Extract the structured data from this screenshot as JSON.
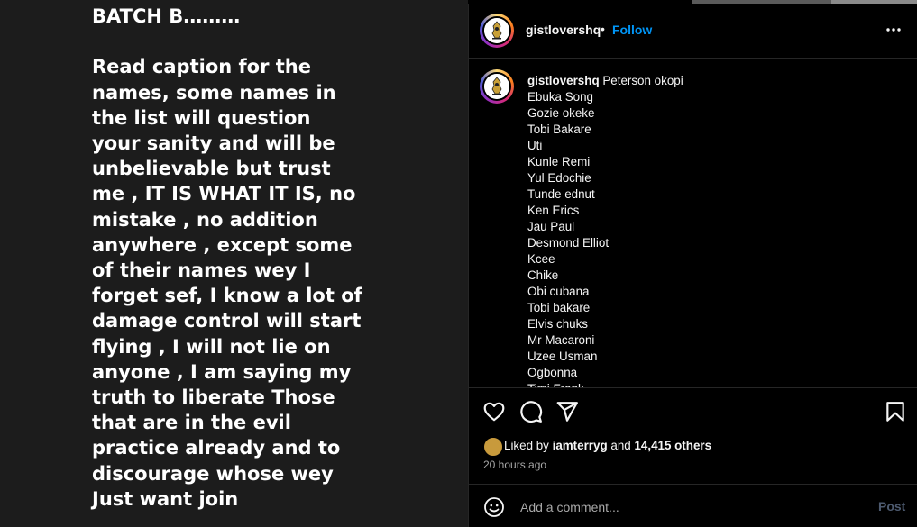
{
  "post_image": {
    "text": "BATCH B………\n\nRead caption for the names, some names in the list will question your sanity and will be unbelievable but trust me , IT IS WHAT IT IS, no mistake , no addition anywhere , except some of their names wey I forget sef, I know a lot of damage control will start flying , I will not lie on anyone , I am saying my truth to liberate Those that are in the evil practice already and to discourage whose wey Just want join"
  },
  "header": {
    "username": "gistlovershq",
    "separator": "•",
    "follow_label": "Follow",
    "more_icon": "more-horizontal-icon"
  },
  "caption": {
    "username": "gistlovershq",
    "first_name": "Peterson okopi",
    "names": [
      "Ebuka Song",
      "Gozie okeke",
      "Tobi Bakare",
      "Uti",
      "Kunle Remi",
      "Yul Edochie",
      "Tunde ednut",
      "Ken Erics",
      "Jau Paul",
      "Desmond Elliot",
      "Kcee",
      "Chike",
      "Obi cubana",
      "Tobi bakare",
      "Elvis chuks",
      "Mr Macaroni",
      "Uzee Usman",
      "Ogbonna",
      "Timi Frank"
    ]
  },
  "actions": {
    "icons": [
      "heart-icon",
      "comment-icon",
      "share-icon",
      "bookmark-icon"
    ]
  },
  "likes": {
    "prefix": "Liked by",
    "user": "iamterryg",
    "and": "and",
    "count": "14,415 others"
  },
  "timestamp": "20 hours ago",
  "comment": {
    "placeholder": "Add a comment...",
    "post_label": "Post"
  },
  "colors": {
    "accent": "#0095f6",
    "background": "#000000",
    "image_bg": "#1c1c1c"
  }
}
